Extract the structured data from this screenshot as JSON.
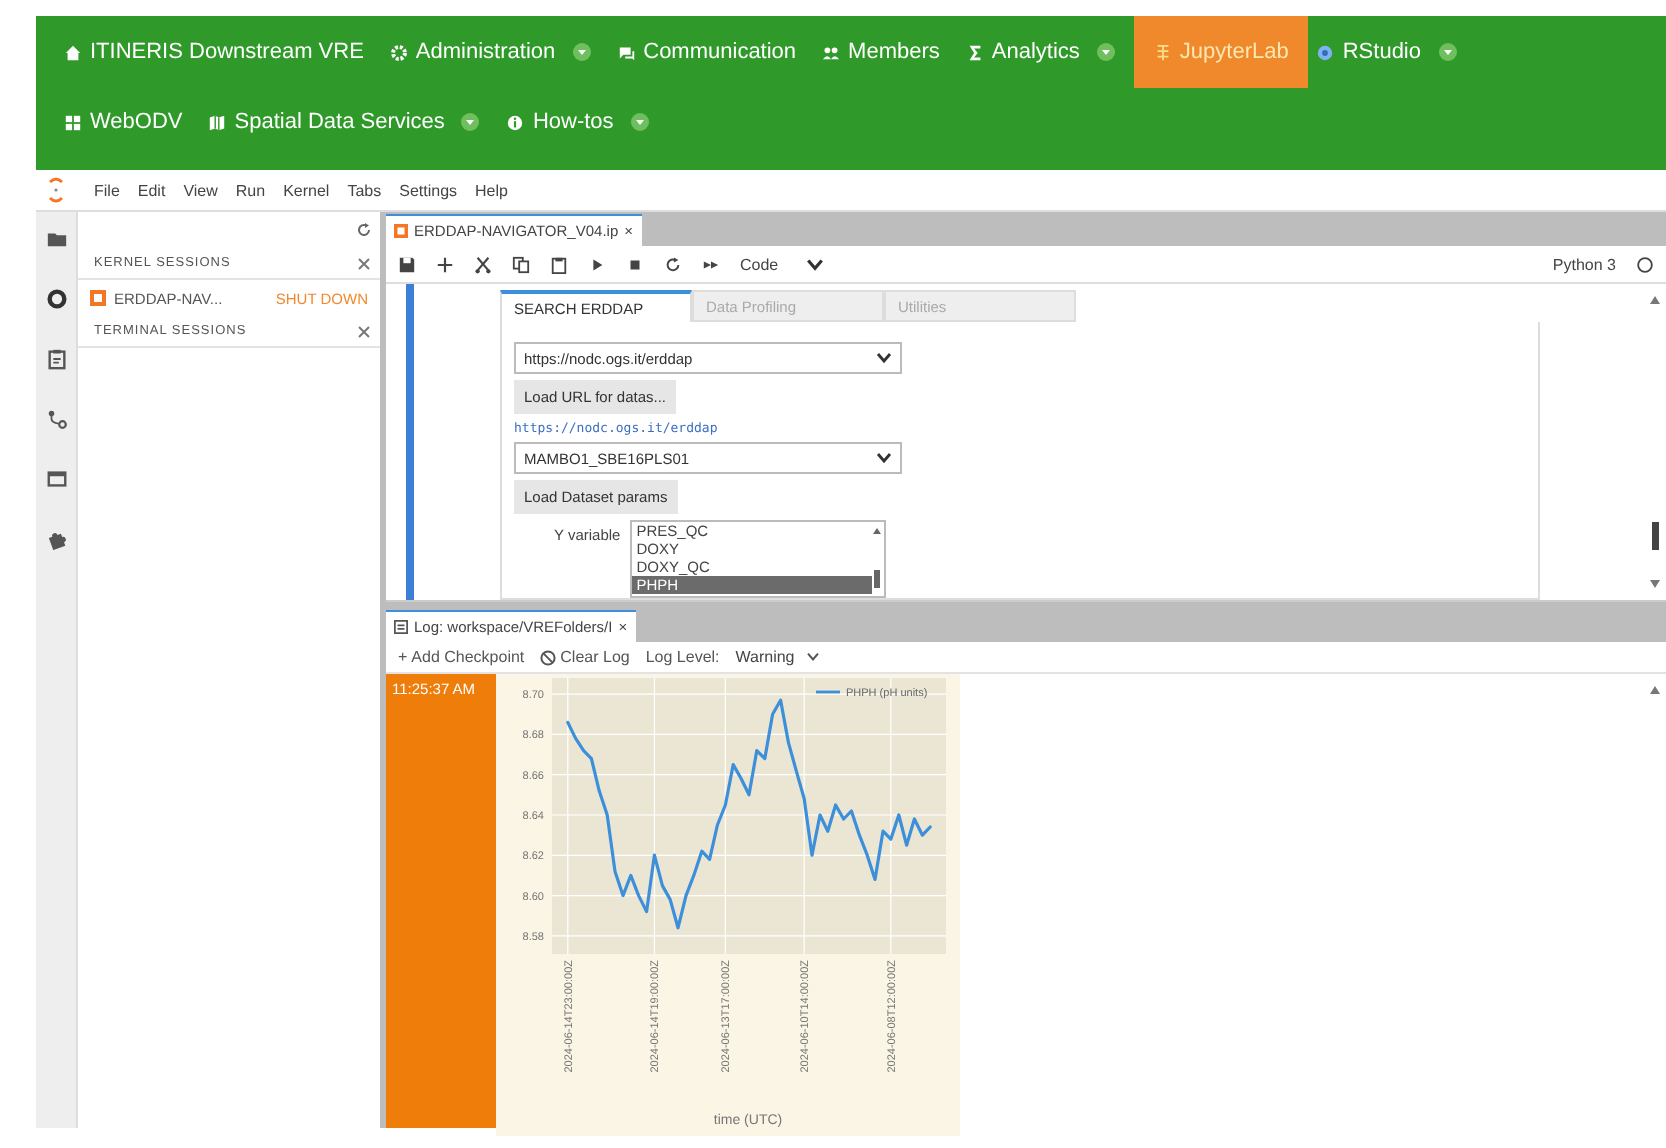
{
  "nav": {
    "rows": [
      [
        {
          "label": "ITINERIS Downstream VRE",
          "dropdown": false,
          "selected": false
        },
        {
          "label": "Administration",
          "dropdown": true,
          "selected": false
        },
        {
          "label": "Communication",
          "dropdown": false,
          "selected": false
        },
        {
          "label": "Members",
          "dropdown": false,
          "selected": false
        },
        {
          "label": "Analytics",
          "dropdown": true,
          "selected": false
        },
        {
          "label": "JupyterLab",
          "dropdown": false,
          "selected": true
        },
        {
          "label": "RStudio",
          "dropdown": true,
          "selected": false
        }
      ],
      [
        {
          "label": "WebODV",
          "dropdown": false,
          "selected": false
        },
        {
          "label": "Spatial Data Services",
          "dropdown": true,
          "selected": false
        },
        {
          "label": "How-tos",
          "dropdown": true,
          "selected": false
        }
      ]
    ]
  },
  "menu_bar": [
    "File",
    "Edit",
    "View",
    "Run",
    "Kernel",
    "Tabs",
    "Settings",
    "Help"
  ],
  "sessions_panel": {
    "sections": [
      {
        "title": "KERNEL SESSIONS",
        "items": [
          {
            "name": "ERDDAP-NAV...",
            "action": "SHUT DOWN"
          }
        ]
      },
      {
        "title": "TERMINAL SESSIONS"
      }
    ]
  },
  "notebook": {
    "tab": {
      "title": "ERDDAP-NAVIGATOR_V04.ip",
      "close": "×"
    },
    "cell_type": "Code",
    "kernel": "Python 3",
    "widget_tabs": [
      {
        "label": "SEARCH ERDDAP",
        "selected": true
      },
      {
        "label": "Data Profiling",
        "selected": false
      },
      {
        "label": "Utilities",
        "selected": false
      }
    ],
    "server_select": "https://nodc.ogs.it/erddap",
    "load_url_button": "Load URL for datas...",
    "server_link": "https://nodc.ogs.it/erddap",
    "dataset_select": "MAMBO1_SBE16PLS01",
    "load_params_button": "Load Dataset params",
    "y_variable": {
      "label": "Y variable",
      "options": [
        {
          "label": "PRES_QC",
          "selected": false
        },
        {
          "label": "DOXY",
          "selected": false
        },
        {
          "label": "DOXY_QC",
          "selected": false
        },
        {
          "label": "PHPH",
          "selected": true
        }
      ]
    }
  },
  "log": {
    "tab": {
      "title": "Log: workspace/VREFolders/I",
      "close": "×"
    },
    "add_checkpoint": "Add Checkpoint",
    "add_icon": "+",
    "clear_log": "Clear Log",
    "log_level_label": "Log Level:",
    "log_level": "Warning",
    "entries": [
      {
        "time": "11:25:37 AM",
        "chart_data": {
          "type": "line",
          "grid": true,
          "xlabel": "time (UTC)",
          "ylim": [
            8.571,
            8.708
          ],
          "yticks": [
            {
              "value": 8.58,
              "label": "8.58"
            },
            {
              "value": 8.6,
              "label": "8.60"
            },
            {
              "value": 8.62,
              "label": "8.62"
            },
            {
              "value": 8.64,
              "label": "8.64"
            },
            {
              "value": 8.66,
              "label": "8.66"
            },
            {
              "value": 8.68,
              "label": "8.68"
            },
            {
              "value": 8.7,
              "label": "8.70"
            }
          ],
          "categories": [
            "2024-06-14T23:00:00Z",
            null,
            null,
            null,
            null,
            null,
            null,
            null,
            null,
            null,
            null,
            "2024-06-14T19:00:00Z",
            null,
            null,
            null,
            null,
            null,
            null,
            null,
            null,
            "2024-06-13T17:00:00Z",
            null,
            null,
            null,
            null,
            null,
            null,
            null,
            null,
            null,
            "2024-06-10T14:00:00Z",
            null,
            null,
            null,
            null,
            null,
            null,
            null,
            null,
            null,
            null,
            "2024-06-08T12:00:00Z",
            null,
            null,
            null,
            null,
            null
          ],
          "series": [
            {
              "name": "PHPH (pH units)",
              "color": "#3d8fd9",
              "values": [
                8.686,
                8.678,
                8.672,
                8.668,
                8.652,
                8.64,
                8.612,
                8.6,
                8.61,
                8.6,
                8.592,
                8.62,
                8.605,
                8.598,
                8.584,
                8.6,
                8.61,
                8.622,
                8.618,
                8.635,
                8.645,
                8.665,
                8.658,
                8.65,
                8.672,
                8.668,
                8.69,
                8.697,
                8.676,
                8.662,
                8.648,
                8.62,
                8.64,
                8.632,
                8.645,
                8.638,
                8.642,
                8.63,
                8.62,
                8.608,
                8.632,
                8.628,
                8.64,
                8.625,
                8.638,
                8.63,
                8.634
              ]
            }
          ]
        }
      }
    ]
  }
}
